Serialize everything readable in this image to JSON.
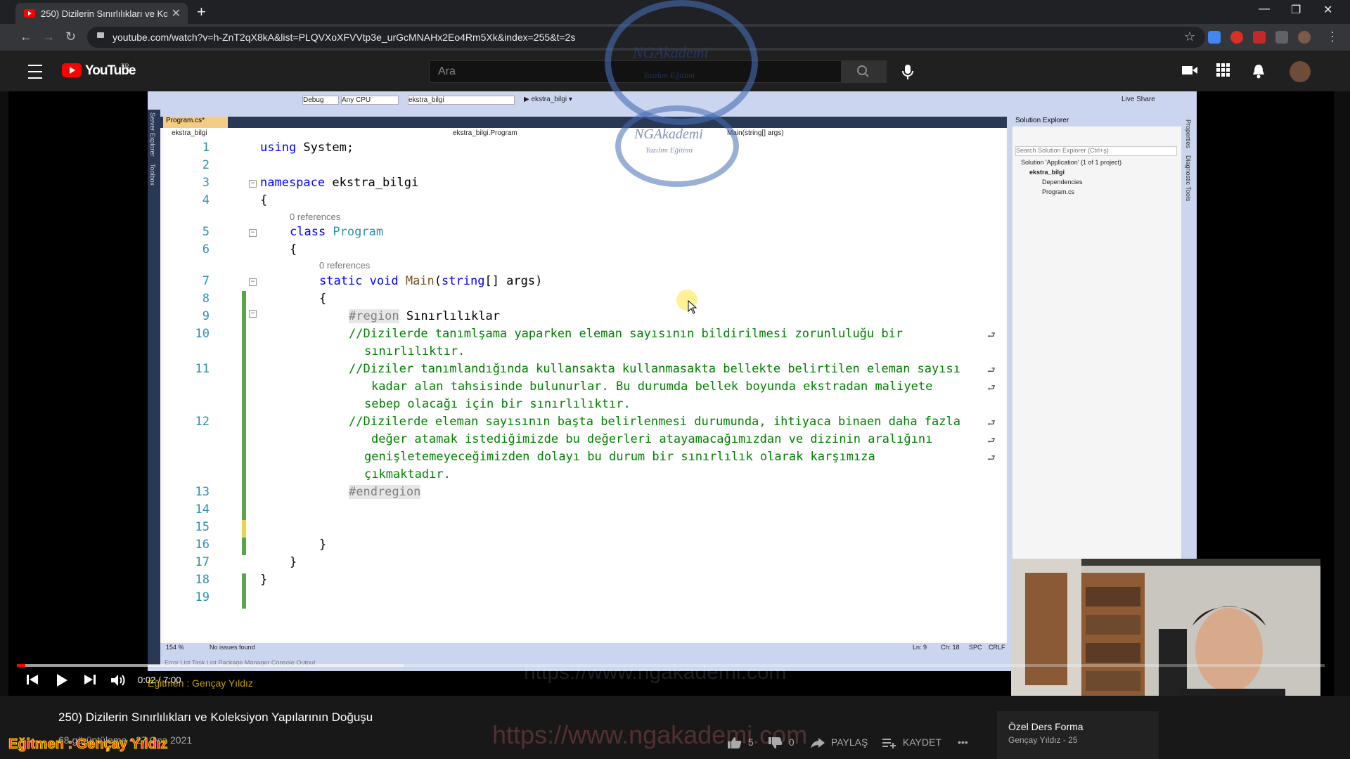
{
  "browser": {
    "tab_title": "250) Dizilerin Sınırlılıkları ve Koleks",
    "tab_close": "✕",
    "new_tab": "+",
    "url": "youtube.com/watch?v=h-ZnT2qX8kA&list=PLQVXoXFVVtp3e_urGcMNAHx2Eo4Rm5Xk&index=255&t=2s",
    "win_min": "—",
    "win_restore": "❐",
    "win_close": "✕"
  },
  "youtube": {
    "logo_text": "YouTube",
    "country": "TR",
    "search_placeholder": "Ara"
  },
  "vs": {
    "toolbar_config": "Debug",
    "toolbar_platform": "Any CPU",
    "toolbar_project": "ekstra_bilgi",
    "toolbar_run": "▶ ekstra_bilgi ▾",
    "live_share": "Live Share",
    "doc_tab": "Program.cs*",
    "nav_project": "ekstra_bilgi",
    "nav_class": "ekstra_bilgi.Program",
    "nav_member": "Main(string[] args)",
    "status_zoom": "154 %",
    "status_issues": "No issues found",
    "status_ln": "Ln: 9",
    "status_ch": "Ch: 18",
    "status_spc": "SPC",
    "status_crlf": "CRLF",
    "bottom_tabs": "Error List   Task List   Package Manager Console   Output",
    "solution_explorer_title": "Solution Explorer",
    "solution_search": "Search Solution Explorer (Ctrl+ş)",
    "solution_root": "Solution 'Application' (1 of 1 project)",
    "solution_project": "ekstra_bilgi",
    "solution_dependencies": "Dependencies",
    "solution_program": "Program.cs",
    "side_server": "Server Explorer",
    "side_toolbox": "Toolbox",
    "side_properties": "Properties",
    "side_diag": "Diagnostic Tools"
  },
  "code": {
    "line_numbers": [
      "1",
      "2",
      "3",
      "4",
      "5",
      "6",
      "7",
      "8",
      "9",
      "10",
      "11",
      "12",
      "13",
      "14",
      "15",
      "16",
      "17",
      "18",
      "19"
    ],
    "ref1": "0 references",
    "ref2": "0 references",
    "l1_kw": "using",
    "l1_rest": " System;",
    "l3_kw": "namespace",
    "l3_rest": " ekstra_bilgi",
    "l4": "{",
    "l5_kw": "class",
    "l5_rest": " Program",
    "l6": "{",
    "l7_kw": "static void",
    "l7_main": " Main",
    "l7_p1": "(",
    "l7_string": "string",
    "l7_rest": "[] args)",
    "l8": "{",
    "l9_kw": "#region",
    "l9_rest": " Sınırlılıklar",
    "l10a": "//Dizilerde tanımlşama yaparken eleman sayısının bildirilmesi zorunluluğu bir",
    "l10b": "sınırlılıktır.",
    "l11a": "//Diziler tanımlandığında kullansakta kullanmasakta bellekte belirtilen eleman sayısı",
    "l11b": "kadar alan tahsisinde bulunurlar. Bu durumda bellek boyunda ekstradan maliyete",
    "l11c": "sebep olacağı için bir sınırlılıktır.",
    "l12a": "//Dizilerde eleman sayısının başta belirlenmesi durumunda, ihtiyaca binaen daha fazla",
    "l12b": "değer atamak istediğimizde bu değerleri atayamacağımızdan ve dizinin aralığını",
    "l12c": "genişletemeyeceğimizden dolayı bu durum bir sınırlılık olarak karşımıza",
    "l12d": "çıkmaktadır.",
    "l13": "#endregion",
    "l16": "}",
    "l17": "}",
    "l18": "}",
    "wrap_glyph": "⮐"
  },
  "player": {
    "time": "0:02 / 7:00",
    "instructor_overlay": "Eğitmen : Gençay Yıldız",
    "url_overlay": "https://www.ngakademi.com"
  },
  "watermark": {
    "brand": "NGAkademi",
    "sub": "Yazılım Eğitimi"
  },
  "video_info": {
    "title": "250) Dizilerin Sınırlılıkları ve Koleksiyon Yapılarının Doğuşu",
    "meta": "68 görüntüleme • 27 Oca 2021",
    "likes": "5",
    "dislikes": "0",
    "share": "PAYLAŞ",
    "save": "KAYDET",
    "more": "•••",
    "instructor_big": "Eğitmen : Gençay Yıldız"
  },
  "promo": {
    "title": "Özel Ders Forma",
    "channel": "Gençay Yıldız - 25"
  }
}
